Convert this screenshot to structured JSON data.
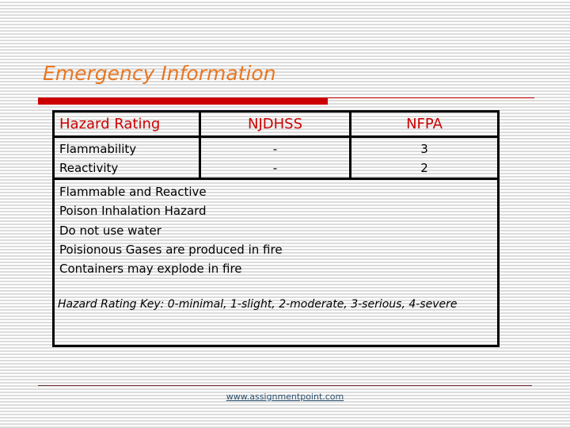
{
  "slide": {
    "title": "Emergency Information",
    "colors": {
      "title": "#e87722",
      "accent_bar": "#cc0000",
      "table_header_text": "#cc0000",
      "border": "#000000",
      "footer_link": "#2a5070"
    }
  },
  "hazard_table": {
    "headers": [
      "Hazard Rating",
      "NJDHSS",
      "NFPA"
    ],
    "rows": [
      [
        "Flammability",
        "-",
        "3"
      ],
      [
        "Reactivity",
        "-",
        "2"
      ]
    ]
  },
  "notes": [
    "Flammable and Reactive",
    "Poison Inhalation Hazard",
    "Do not use water",
    "Poisionous Gases are produced in fire",
    "Containers may explode in fire"
  ],
  "key_text": "Hazard Rating Key: 0-minimal, 1-slight, 2-moderate, 3-serious, 4-severe",
  "footer": {
    "link_text": "www.assignmentpoint.com"
  }
}
